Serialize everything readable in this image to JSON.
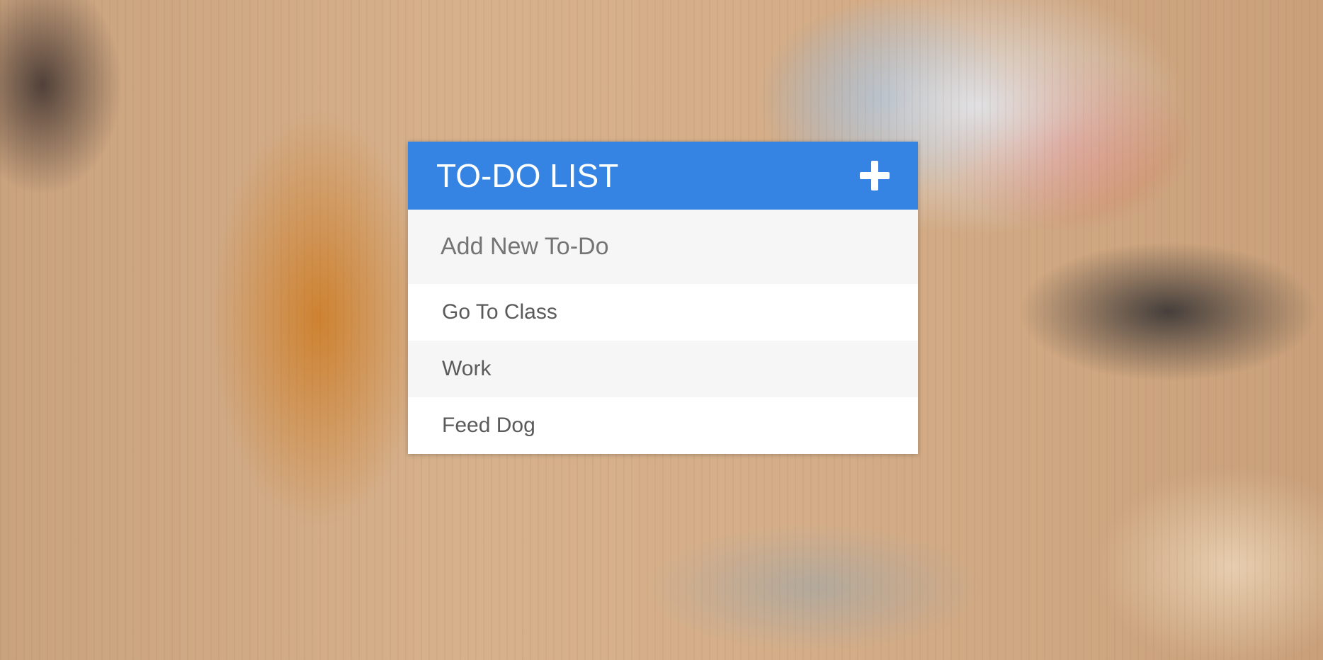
{
  "app": {
    "title": "TO-DO LIST",
    "accent_color": "#3584e4",
    "add_icon": "plus-icon"
  },
  "input": {
    "placeholder": "Add New To-Do",
    "value": ""
  },
  "todos": [
    {
      "label": "Go To Class"
    },
    {
      "label": "Work"
    },
    {
      "label": "Feed Dog"
    }
  ]
}
